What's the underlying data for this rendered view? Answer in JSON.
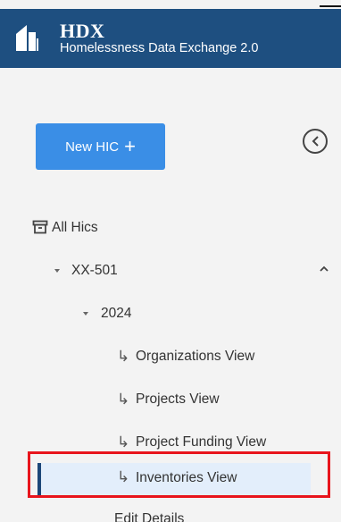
{
  "app": {
    "brand": "HDX",
    "subtitle": "Homelessness Data Exchange 2.0",
    "logo_icon": "building-logo-icon"
  },
  "sidebar": {
    "new_button": {
      "label": "New HIC",
      "icon": "+"
    },
    "collapse_icon": "chevron-left-circle-icon",
    "items": [
      {
        "label": "All Hics",
        "icon": "archive-box-icon"
      },
      {
        "label": "XX-501",
        "icon": "caret-down-icon",
        "expand_icon": "chevron-up-icon"
      },
      {
        "label": "2024",
        "icon": "caret-down-icon"
      },
      {
        "label": "Organizations View",
        "icon": "subdirectory-arrow-icon"
      },
      {
        "label": "Projects View",
        "icon": "subdirectory-arrow-icon"
      },
      {
        "label": "Project Funding View",
        "icon": "subdirectory-arrow-icon"
      },
      {
        "label": "Inventories View",
        "icon": "subdirectory-arrow-icon",
        "active": true
      },
      {
        "label": "Edit Details"
      }
    ],
    "sub_arrow_glyph": "↳"
  },
  "colors": {
    "header_bg": "#1e4f80",
    "button_bg": "#3a8ee6",
    "active_bar": "#1c4678",
    "active_bg": "#e3eefb",
    "highlight": "#e8141c"
  }
}
